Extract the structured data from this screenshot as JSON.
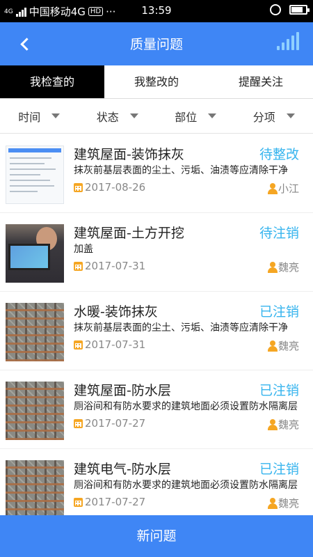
{
  "statusbar": {
    "carrier_prefix": "4G",
    "carrier": "中国移动4G",
    "time": "13:59",
    "dots": "···",
    "call_label": "HD",
    "battery_level": 0.8
  },
  "header": {
    "title": "质量问题",
    "back_icon": "chevron-left-icon",
    "signal_icon": "signal-bars-icon"
  },
  "tabs": [
    {
      "label": "我检查的",
      "active": true
    },
    {
      "label": "我整改的",
      "active": false
    },
    {
      "label": "提醒关注",
      "active": false
    }
  ],
  "filters": [
    {
      "label": "时间"
    },
    {
      "label": "状态"
    },
    {
      "label": "部位"
    },
    {
      "label": "分项"
    }
  ],
  "items": [
    {
      "title": "建筑屋面-装饰抹灰",
      "status": "待整改",
      "desc": "抹灰前基层表面的尘土、污垢、油渍等应清除干净",
      "date": "2017-08-26",
      "user": "小江",
      "thumb": "document"
    },
    {
      "title": "建筑屋面-土方开挖",
      "status": "待注销",
      "desc": "加盖",
      "date": "2017-07-31",
      "user": "魏亮",
      "thumb": "photo"
    },
    {
      "title": "水暖-装饰抹灰",
      "status": "已注销",
      "desc": "抹灰前基层表面的尘土、污垢、油渍等应清除干净",
      "date": "2017-07-31",
      "user": "魏亮",
      "thumb": "rebar"
    },
    {
      "title": "建筑屋面-防水层",
      "status": "已注销",
      "desc": "厕浴间和有防水要求的建筑地面必须设置防水隔离层",
      "date": "2017-07-27",
      "user": "魏亮",
      "thumb": "rebar"
    },
    {
      "title": "建筑电气-防水层",
      "status": "已注销",
      "desc": "厕浴间和有防水要求的建筑地面必须设置防水隔离层",
      "date": "2017-07-27",
      "user": "魏亮",
      "thumb": "rebar"
    }
  ],
  "footer": {
    "button_label": "新问题"
  },
  "colors": {
    "primary": "#3f86f5",
    "status": "#36b4ee",
    "accent": "#f5a623"
  }
}
